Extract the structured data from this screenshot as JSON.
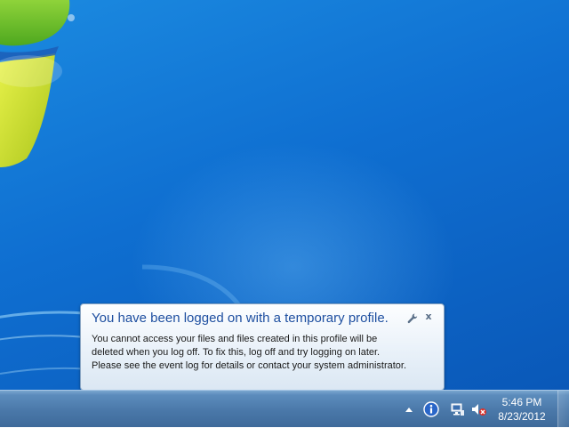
{
  "notification": {
    "title": "You have been logged on with a temporary profile.",
    "body_lines": [
      "You cannot access your files and files created in this profile will be",
      "deleted when you log off. To fix this, log off and try logging on later.",
      "Please see the event log for details or contact your system administrator."
    ],
    "close_label": "x",
    "options_icon": "wrench-icon"
  },
  "taskbar": {
    "tray_icons": [
      "show-hidden-icons-arrow",
      "action-center-info-icon",
      "network-icon",
      "volume-muted-icon"
    ],
    "clock": {
      "time": "5:46 PM",
      "date": "8/23/2012"
    }
  },
  "colors": {
    "desktop": "#0f6fd1",
    "taskbar": "#4a78a9",
    "balloon_title": "#1e4fa0"
  }
}
